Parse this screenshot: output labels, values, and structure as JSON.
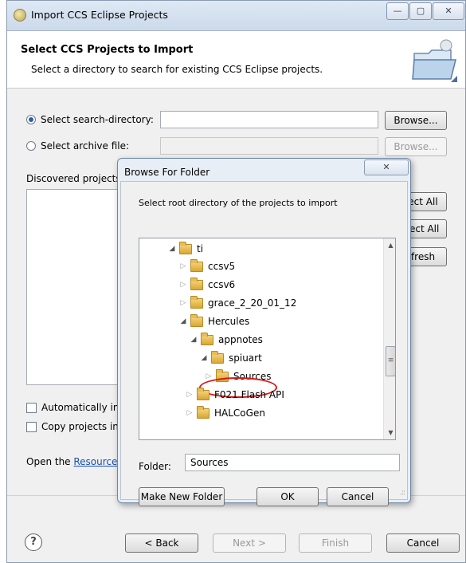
{
  "window": {
    "title": "Import CCS Eclipse Projects",
    "controls": {
      "minimize": "—",
      "maximize": "▢",
      "close": "✕"
    }
  },
  "header": {
    "title": "Select CCS Projects to Import",
    "subtitle": "Select a directory to search for existing CCS Eclipse projects."
  },
  "options": {
    "search_directory_label": "Select search-directory:",
    "search_directory_value": "",
    "archive_file_label": "Select archive file:",
    "archive_file_value": "",
    "browse_label": "Browse...",
    "browse_archive_label": "Browse..."
  },
  "projects": {
    "label": "Discovered projects",
    "select_all_label": "ect All",
    "deselect_all_label": "lect All",
    "refresh_label": "fresh"
  },
  "checkboxes": {
    "auto_import_label": "Automatically in",
    "copy_projects_label": "Copy projects in"
  },
  "resource_line": {
    "prefix": "Open the ",
    "link": "Resource"
  },
  "footer": {
    "help": "?",
    "back_label": "< Back",
    "next_label": "Next >",
    "finish_label": "Finish",
    "cancel_label": "Cancel"
  },
  "dialog": {
    "title": "Browse For Folder",
    "close": "✕",
    "instruction": "Select root directory of the projects to import",
    "tree": [
      {
        "label": "ti",
        "expander": "◢",
        "state": "expanded"
      },
      {
        "label": "ccsv5",
        "expander": "▷",
        "state": "collapsed"
      },
      {
        "label": "ccsv6",
        "expander": "▷",
        "state": "collapsed"
      },
      {
        "label": "grace_2_20_01_12",
        "expander": "▷",
        "state": "collapsed"
      },
      {
        "label": "Hercules",
        "expander": "◢",
        "state": "expanded"
      },
      {
        "label": "appnotes",
        "expander": "◢",
        "state": "expanded"
      },
      {
        "label": "spiuart",
        "expander": "◢",
        "state": "expanded"
      },
      {
        "label": "Sources",
        "expander": "▷",
        "state": "selected"
      },
      {
        "label": "F021 Flash API",
        "expander": "▷",
        "state": "collapsed"
      },
      {
        "label": "HALCoGen",
        "expander": "▷",
        "state": "collapsed"
      }
    ],
    "folder_label": "Folder:",
    "folder_value": "Sources",
    "make_new_folder_label": "Make New Folder",
    "ok_label": "OK",
    "cancel_label": "Cancel"
  },
  "colors": {
    "link": "#1a4fb1",
    "highlight": "#d51a1a"
  }
}
